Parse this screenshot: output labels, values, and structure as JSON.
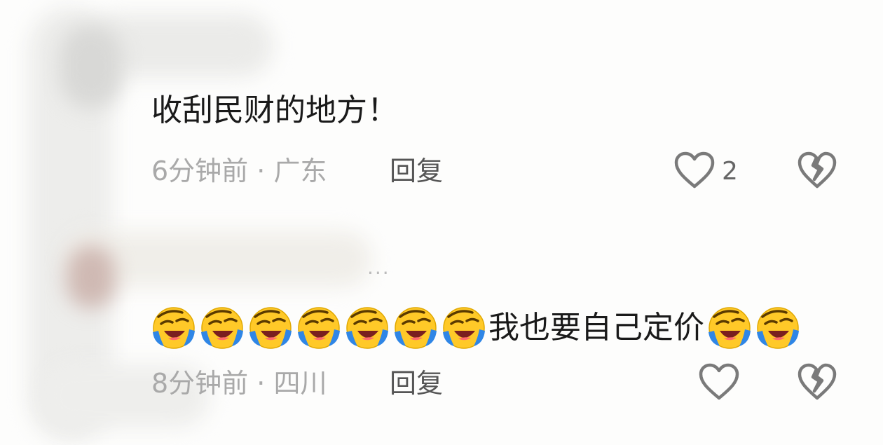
{
  "comments": [
    {
      "text": "收刮民财的地方！",
      "time": "6分钟前",
      "location": "广东",
      "reply_label": "回复",
      "like_count": "2"
    },
    {
      "leading_emoji_count": 7,
      "text": "我也要自己定价",
      "trailing_emoji_count": 2,
      "time": "8分钟前",
      "location": "四川",
      "reply_label": "回复",
      "like_count": ""
    }
  ],
  "ellipsis": "...",
  "separator": " · ",
  "icons": {
    "like": "heart-outline-icon",
    "dislike": "broken-heart-icon",
    "emoji": "laughing-crying-emoji"
  },
  "colors": {
    "text": "#1a1a1a",
    "meta": "#a9a9a9",
    "icon": "#7a7a7a",
    "emoji_face": "#ffc928",
    "emoji_tears": "#2f86e6"
  }
}
